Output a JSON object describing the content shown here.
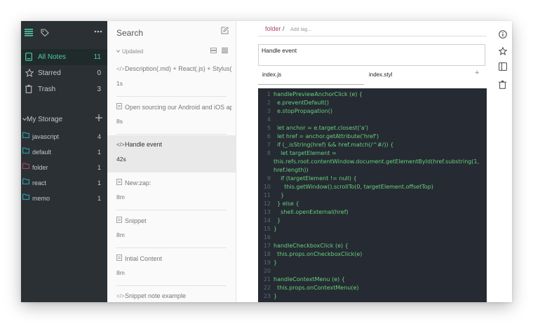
{
  "sidebar": {
    "nav": [
      {
        "label": "All Notes",
        "count": "11",
        "icon": "notes-icon"
      },
      {
        "label": "Starred",
        "count": "0",
        "icon": "star-icon"
      },
      {
        "label": "Trash",
        "count": "3",
        "icon": "trash-icon"
      }
    ],
    "storage_label": "My Storage",
    "folders": [
      {
        "name": "javascript",
        "count": "4",
        "color": "#2ea9c4"
      },
      {
        "name": "default",
        "count": "1",
        "color": "#2ea9c4"
      },
      {
        "name": "folder",
        "count": "1",
        "color": "#b0476b"
      },
      {
        "name": "react",
        "count": "1",
        "color": "#2ea9c4"
      },
      {
        "name": "memo",
        "count": "1",
        "color": "#2ea9c4"
      }
    ]
  },
  "notelist": {
    "search_label": "Search",
    "sort_label": "Updated",
    "notes": [
      {
        "title": "Description(.md) + React(.js) + Stylus(.styl)",
        "time": "1s",
        "type": "snippet"
      },
      {
        "title": "Open sourcing our Android and iOS apps",
        "time": "8s",
        "type": "markdown"
      },
      {
        "title": "Handle event",
        "time": "42s",
        "type": "snippet"
      },
      {
        "title": "New:zap:",
        "time": "8m",
        "type": "markdown"
      },
      {
        "title": "Snippet",
        "time": "8m",
        "type": "markdown"
      },
      {
        "title": "Intial Content",
        "time": "8m",
        "type": "markdown"
      },
      {
        "title": "Snippet note example",
        "time": "",
        "type": "snippet"
      }
    ]
  },
  "editor": {
    "folder": "folder",
    "separator": "/",
    "add_tag": "Add tag...",
    "description": "Handle event",
    "tabs": [
      "index.js",
      "index.styl"
    ],
    "add_file": "+",
    "code_lines": [
      {
        "n": "1",
        "t": "handlePreviewAnchorClick (e) {"
      },
      {
        "n": "2",
        "t": "  e.preventDefault()"
      },
      {
        "n": "3",
        "t": "  e.stopPropagation()"
      },
      {
        "n": "4",
        "t": ""
      },
      {
        "n": "5",
        "t": "  let anchor = e.target.closest('a')"
      },
      {
        "n": "6",
        "t": "  let href = anchor.getAttribute('href')"
      },
      {
        "n": "7",
        "t": "  if (_.isString(href) && href.match(/^#/)) {"
      },
      {
        "n": "8",
        "t": "    let targetElement ="
      },
      {
        "n": "",
        "t": "this.refs.root.contentWindow.document.getElementById(href.substring(1,"
      },
      {
        "n": "",
        "t": "href.length))"
      },
      {
        "n": "9",
        "t": "    if (targetElement != null) {"
      },
      {
        "n": "10",
        "t": "      this.getWindow().scrollTo(0, targetElement.offsetTop)"
      },
      {
        "n": "11",
        "t": "    }"
      },
      {
        "n": "12",
        "t": "  } else {"
      },
      {
        "n": "13",
        "t": "    shell.openExternal(href)"
      },
      {
        "n": "14",
        "t": "  }"
      },
      {
        "n": "15",
        "t": "}"
      },
      {
        "n": "16",
        "t": ""
      },
      {
        "n": "17",
        "t": "handleCheckboxClick (e) {"
      },
      {
        "n": "18",
        "t": "  this.props.onCheckboxClick(e)"
      },
      {
        "n": "19",
        "t": "}"
      },
      {
        "n": "20",
        "t": ""
      },
      {
        "n": "21",
        "t": "handleContextMenu (e) {"
      },
      {
        "n": "22",
        "t": "  this.props.onContextMenu(e)"
      },
      {
        "n": "23",
        "t": "}"
      },
      {
        "n": "24",
        "t": ""
      }
    ]
  },
  "colors": {
    "sidebar_bg": "#2b3034",
    "accent": "#50c9a2",
    "code_bg": "#262a33",
    "code_text": "#66d17a",
    "folder_red": "#b0476b"
  },
  "toolbar_icons": [
    "info-icon",
    "star-icon",
    "sidebar-toggle-icon",
    "trash-icon"
  ]
}
